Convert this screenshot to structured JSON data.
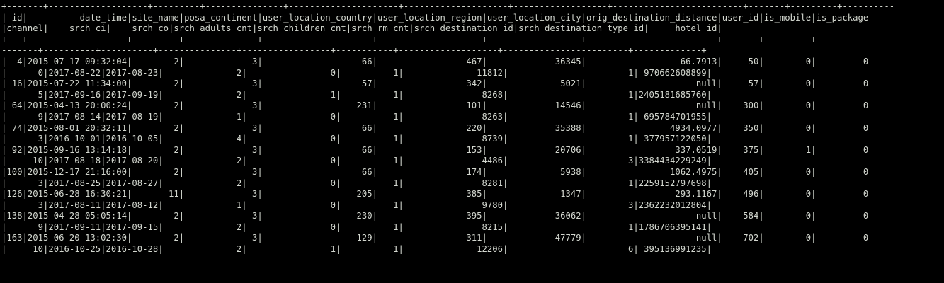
{
  "terminal": {
    "fg_color": "#d3d7cf",
    "bg_color": "#000000",
    "lines": [
      "+-------+-------------------+---------+---------------+---------------------+--------------------+------------------+-------------------------+-------+---------+----------",
      "| id|          date_time|site_name|posa_continent|user_location_country|user_location_region|user_location_city|orig_destination_distance|user_id|is_mobile|is_package",
      "|channel|    srch_ci|    srch_co|srch_adults_cnt|srch_children_cnt|srch_rm_cnt|srch_destination_id|srch_destination_type_id|     hotel_id|",
      "+---+-------------------+---------+--------------+---------------------+--------------------+------------------+-------------------------+-------+---------+----------",
      "-------+----------+----------+---------------+-----------------+-----------+-------------------+------------------------+-------------+",
      "|  4|2015-07-17 09:32:04|        2|             3|                   66|                 467|             36345|                  66.7913|     50|        0|         0",
      "|      0|2017-08-22|2017-08-23|              2|                0|          1|              11812|                       1| 970662608899|",
      "| 16|2015-07-22 11:34:00|        2|             3|                   57|                 342|              5021|                     null|     57|        0|         0",
      "|      5|2017-09-16|2017-09-19|              2|                1|          1|               8268|                       1|2405181685760|",
      "| 64|2015-04-13 20:00:24|        2|             3|                  231|                 101|             14546|                     null|    300|        0|         0",
      "|      9|2017-08-14|2017-08-19|              1|                0|          1|               8263|                       1| 695784701955|",
      "| 74|2015-08-01 20:32:11|        2|             3|                   66|                 220|             35388|                4934.0977|    350|        0|         0",
      "|      3|2016-10-01|2016-10-05|              4|                0|          1|               8739|                       1| 377957122050|",
      "| 92|2015-09-16 13:14:18|        2|             3|                   66|                 153|             20706|                 337.0519|    375|        1|         0",
      "|     10|2017-08-18|2017-08-20|              2|                0|          1|               4486|                       3|3384434229249|",
      "|100|2015-12-17 21:16:00|        2|             3|                   66|                 174|              5938|                1062.4975|    405|        0|         0",
      "|      3|2017-08-25|2017-08-27|              2|                0|          1|               8281|                       1|2259152797698|",
      "|126|2015-06-28 16:30:21|       11|             3|                  205|                 385|              1347|                 293.1167|    496|        0|         0",
      "|      3|2017-08-11|2017-08-12|              1|                0|          1|               9780|                       3|2362232012804|",
      "|138|2015-04-28 05:05:14|        2|             3|                  230|                 395|             36062|                     null|    584|        0|         0",
      "|      9|2017-09-11|2017-09-15|              2|                0|          1|               8215|                       1|1786706395141|",
      "|163|2015-06-20 13:02:30|        2|             3|                  129|                 311|             47779|                     null|    702|        0|         0",
      "|     10|2016-10-25|2016-10-28|              2|                1|          1|              12206|                       6| 395136991235|"
    ]
  }
}
